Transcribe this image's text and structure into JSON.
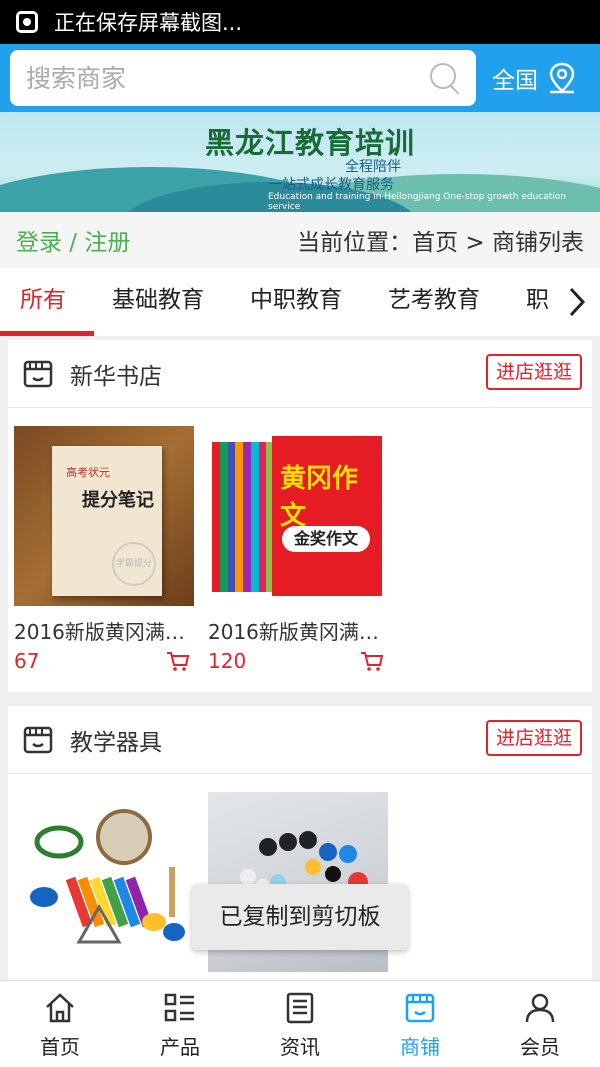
{
  "status_bar": {
    "text": "正在保存屏幕截图..."
  },
  "search": {
    "placeholder": "搜索商家",
    "region": "全国"
  },
  "banner": {
    "title": "黑龙江教育培训",
    "subtitle1": "全程陪伴",
    "subtitle2": "一站式成长教育服务",
    "subtitle3": "Education and training in Heilongjiang One-stop growth education service"
  },
  "crumb": {
    "login": "登录",
    "sep": " / ",
    "register": "注册",
    "location": "当前位置：首页 > 商铺列表"
  },
  "tabs": [
    "所有",
    "基础教育",
    "中职教育",
    "艺考教育",
    "职"
  ],
  "shops": [
    {
      "name": "新华书店",
      "enter_label": "进店逛逛",
      "products": [
        {
          "title": "2016新版黄冈满…",
          "price": "67"
        },
        {
          "title": "2016新版黄冈满…",
          "price": "120"
        }
      ]
    },
    {
      "name": "教学器具",
      "enter_label": "进店逛逛",
      "products": []
    }
  ],
  "book1_cover": {
    "line1": "高考状元",
    "line2": "提分笔记",
    "stamp": "学霸提分"
  },
  "book2_cover": {
    "big": "黄冈作文",
    "pill": "金奖作文"
  },
  "toast": "已复制到剪切板",
  "bottom_nav": [
    {
      "label": "首页",
      "icon": "home-icon"
    },
    {
      "label": "产品",
      "icon": "list-icon"
    },
    {
      "label": "资讯",
      "icon": "news-icon"
    },
    {
      "label": "商铺",
      "icon": "shop-icon"
    },
    {
      "label": "会员",
      "icon": "user-icon"
    }
  ],
  "colors": {
    "primary": "#21a0ee",
    "accent": "#e0242a",
    "login": "#4caf50"
  }
}
